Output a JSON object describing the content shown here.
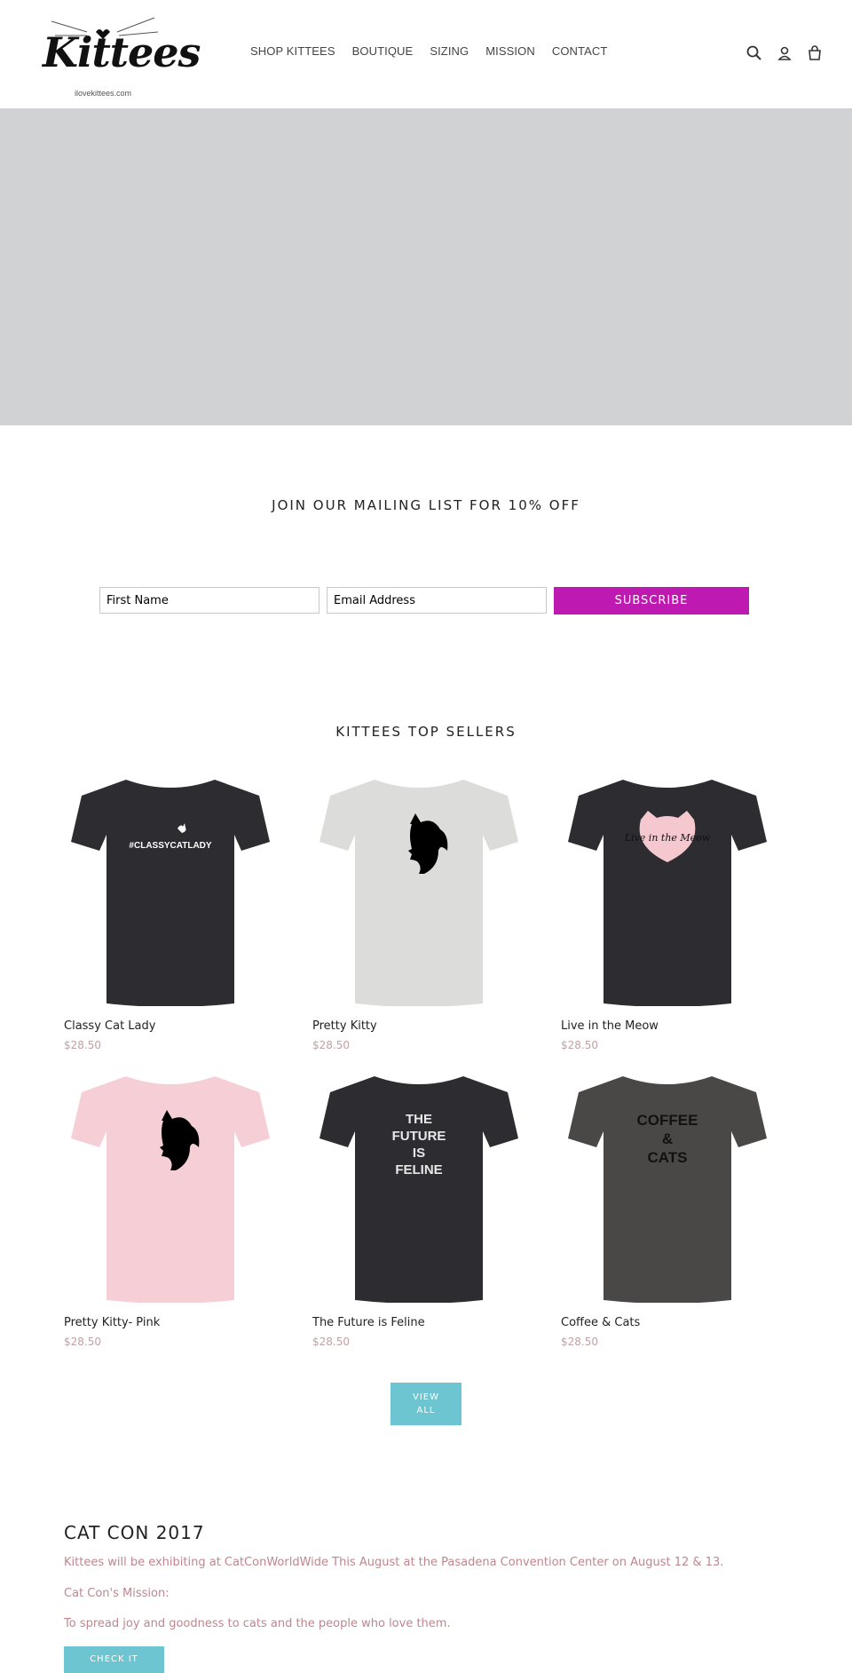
{
  "header": {
    "logo_text": "Kittees",
    "logo_subtitle": "ilovekittees.com",
    "nav": [
      "SHOP KITTEES",
      "BOUTIQUE",
      "SIZING",
      "MISSION",
      "CONTACT"
    ],
    "icons": [
      "search-icon",
      "account-icon",
      "cart-icon"
    ]
  },
  "hero": {
    "color": "#d1d2d4"
  },
  "mailing": {
    "title": "JOIN OUR MAILING LIST FOR 10% OFF",
    "first_name_placeholder": "First Name",
    "email_placeholder": "Email Address",
    "subscribe_label": "SUBSCRIBE",
    "button_color": "#be1ab1"
  },
  "sellers": {
    "title": "KITTEES TOP SELLERS",
    "products": [
      {
        "name": "Classy Cat Lady",
        "price": "$28.50",
        "shirt_color": "#2d2c31",
        "print": "#CLASSYCATLADY"
      },
      {
        "name": "Pretty Kitty",
        "price": "$28.50",
        "shirt_color": "#dcdcda",
        "print": ""
      },
      {
        "name": "Live in the Meow",
        "price": "$28.50",
        "shirt_color": "#2d2c31",
        "print": "Live in the Meow"
      },
      {
        "name": "Pretty Kitty- Pink",
        "price": "$28.50",
        "shirt_color": "#f6cfd6",
        "print": ""
      },
      {
        "name": "The Future is Feline",
        "price": "$28.50",
        "shirt_color": "#2d2c31",
        "print": "THE FUTURE IS FELINE"
      },
      {
        "name": "Coffee & Cats",
        "price": "$28.50",
        "shirt_color": "#4a4747",
        "print": "COFFEE & CATS"
      }
    ],
    "view_all_line1": "VIEW",
    "view_all_line2": "ALL"
  },
  "catcon": {
    "title": "CAT CON 2017",
    "p1": "Kittees will be exhibiting at CatConWorldWide This August at the Pasadena Convention Center on August 12 & 13.",
    "p2": "Cat Con's Mission:",
    "p3": "To spread joy and goodness to cats and the people who love them.",
    "button_label": "CHECK IT"
  },
  "colors": {
    "accent": "#6cc5d0",
    "price": "#c0a1a4",
    "body_text": "#c0868e"
  }
}
